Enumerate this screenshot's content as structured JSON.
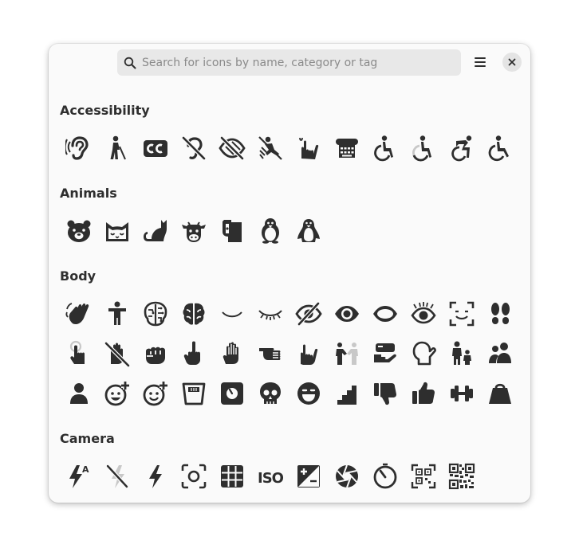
{
  "search": {
    "placeholder": "Search for icons by name, category or tag"
  },
  "header": {
    "menu_icon": "hamburger-menu-icon",
    "close_icon": "close-icon"
  },
  "colors": {
    "icon": "#2e2e2e",
    "window_bg": "#fafafa",
    "search_bg": "#e8e8e8"
  },
  "sections": [
    {
      "title": "Accessibility",
      "icons": [
        "ear",
        "person-with-cane",
        "cc",
        "hearing-disabled",
        "eye-disabled",
        "fall",
        "sign-language",
        "tty",
        "wheelchair",
        "wheelchair-alt",
        "wheelchair-active",
        "wheelchair-accessible"
      ]
    },
    {
      "title": "Animals",
      "icons": [
        "bear",
        "cat",
        "cat-tail",
        "cow",
        "dog",
        "penguin",
        "penguin-alt"
      ]
    },
    {
      "title": "Body",
      "icons": [
        "hand-wave",
        "person",
        "brain-circuit",
        "brain",
        "eye-closed-smile",
        "eye-closed-lashes",
        "eye-slash",
        "eye-filled",
        "eye-outline",
        "eye-open-lashes",
        "face-scan",
        "footprints",
        "hand-touch",
        "hand-disabled",
        "fist",
        "middle-finger",
        "hand-open",
        "hand-point",
        "rock-hand",
        "people-handshake",
        "hand-pay",
        "mitten",
        "adult-child",
        "people-group",
        "person-filled",
        "face-plus",
        "face-plus-outline",
        "scale",
        "scale-square",
        "skull",
        "face-laugh",
        "stairs",
        "thumbs-down",
        "thumbs-up",
        "dumbbell",
        "weight"
      ]
    },
    {
      "title": "Camera",
      "icons": [
        "flash-auto",
        "flash-off",
        "flash",
        "focus",
        "grid",
        "iso",
        "exposure",
        "aperture",
        "timer",
        "qr-scan",
        "qr-code"
      ]
    }
  ]
}
